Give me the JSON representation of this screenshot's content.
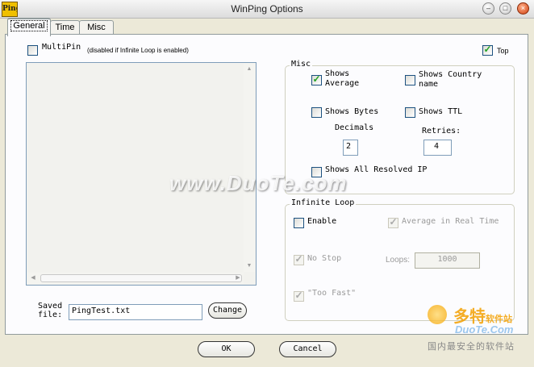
{
  "window": {
    "title": "WinPing Options",
    "app_icon_text": "Ping!"
  },
  "title_buttons": {
    "minimize": "–",
    "maximize": "□",
    "close": "×"
  },
  "tabs": [
    {
      "label": "General",
      "active": true
    },
    {
      "label": "Time",
      "active": false
    },
    {
      "label": "Misc",
      "active": false
    }
  ],
  "multipin": {
    "label": "MultiPin",
    "note": "(disabled if Infinite Loop is enabled)",
    "checked": false
  },
  "top": {
    "label": "Top",
    "checked": true
  },
  "misc": {
    "legend": "Misc",
    "shows_average": {
      "label_line1": "Shows",
      "label_line2": "Average",
      "checked": true
    },
    "shows_country": {
      "label_line1": "Shows Country",
      "label_line2": "name",
      "checked": false
    },
    "shows_bytes": {
      "label": "Shows Bytes",
      "checked": false
    },
    "shows_ttl": {
      "label": "Shows TTL",
      "checked": false
    },
    "decimals": {
      "label": "Decimals",
      "value": "2"
    },
    "retries": {
      "label": "Retries:",
      "value": "4"
    },
    "shows_all_resolved_ip": {
      "label": "Shows All Resolved IP",
      "checked": false
    }
  },
  "infinite_loop": {
    "legend": "Infinite Loop",
    "enable": {
      "label": "Enable",
      "checked": false
    },
    "average_real_time": {
      "label": "Average in Real Time",
      "checked": true,
      "disabled": true
    },
    "no_stop": {
      "label": "No Stop",
      "checked": true,
      "disabled": true
    },
    "loops": {
      "label": "Loops:",
      "value": "1000"
    },
    "too_fast": {
      "label": "\"Too Fast\"",
      "checked": true,
      "disabled": true
    }
  },
  "saved_file": {
    "label_line1": "Saved",
    "label_line2": "file:",
    "value": "PingTest.txt",
    "change_label": "Change"
  },
  "buttons": {
    "ok": "OK",
    "cancel": "Cancel"
  },
  "watermark": {
    "text": "www.DuoTe.com",
    "logo_cn_big": "多特",
    "logo_cn_small": "软件站",
    "logo_en": "DuoTe.Com",
    "logo_tagline": "国内最安全的软件站"
  },
  "colors": {
    "checkmark": "#21a121",
    "tab_highlight": "#e9a53a",
    "close_button": "#d04010"
  },
  "icons": [
    "scroll-up-arrow-icon",
    "scroll-down-arrow-icon",
    "scroll-left-arrow-icon",
    "scroll-right-arrow-icon"
  ]
}
